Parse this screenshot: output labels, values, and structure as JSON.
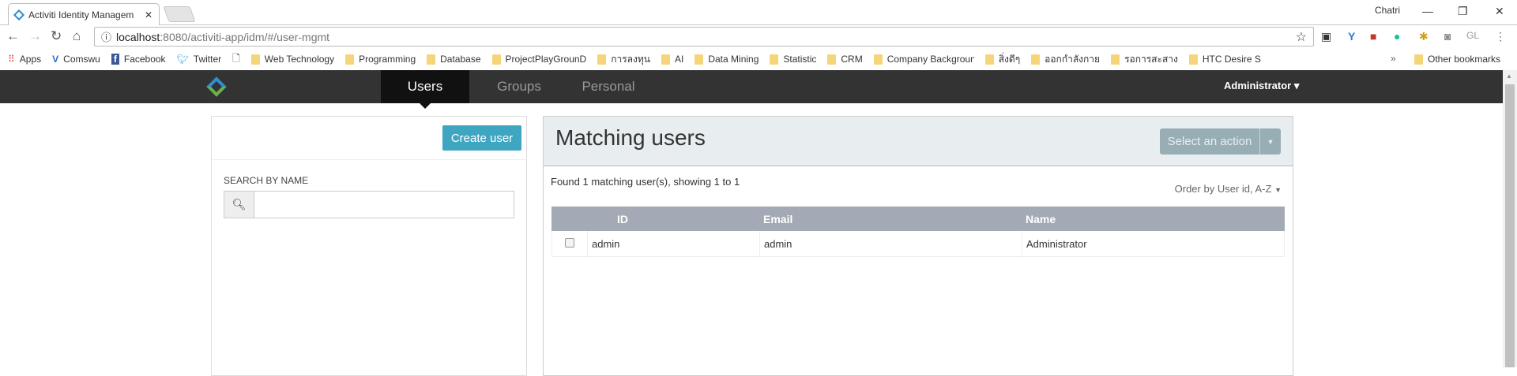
{
  "browser": {
    "tab_title": "Activiti Identity Managem",
    "profile": "Chatri",
    "url_host": "localhost",
    "url_rest": ":8080/activiti-app/idm/#/user-mgmt",
    "bookmarks": [
      "Apps",
      "Comswu",
      "Facebook",
      "Twitter",
      "",
      "Web Technology",
      "Programming",
      "Database",
      "ProjectPlayGrounD",
      "การลงทุน",
      "AI",
      "Data Mining",
      "Statistic",
      "CRM",
      "Company Backgroun",
      "สิ่งดีๆ",
      "ออกกำลังกาย",
      "รอการสะสาง",
      "HTC Desire S"
    ],
    "other_bookmarks": "Other bookmarks",
    "extensions": [
      "GL"
    ]
  },
  "nav": {
    "tabs": [
      {
        "label": "Users",
        "active": true
      },
      {
        "label": "Groups"
      },
      {
        "label": "Personal"
      }
    ],
    "user": "Administrator"
  },
  "left": {
    "create_label": "Create user",
    "search_label": "SEARCH BY NAME",
    "search_value": ""
  },
  "main": {
    "title": "Matching users",
    "action_label": "Select an action",
    "found_text": "Found 1 matching user(s), showing 1 to 1",
    "order_label": "Order by User id, A-Z",
    "columns": [
      "ID",
      "Email",
      "Name"
    ],
    "rows": [
      {
        "id": "admin",
        "email": "admin",
        "name": "Administrator",
        "checked": false
      }
    ]
  },
  "colors": {
    "navbar": "#333333",
    "accent": "#3fa6c2",
    "table_header": "#a3aab5",
    "action_button": "#97aeb5"
  }
}
